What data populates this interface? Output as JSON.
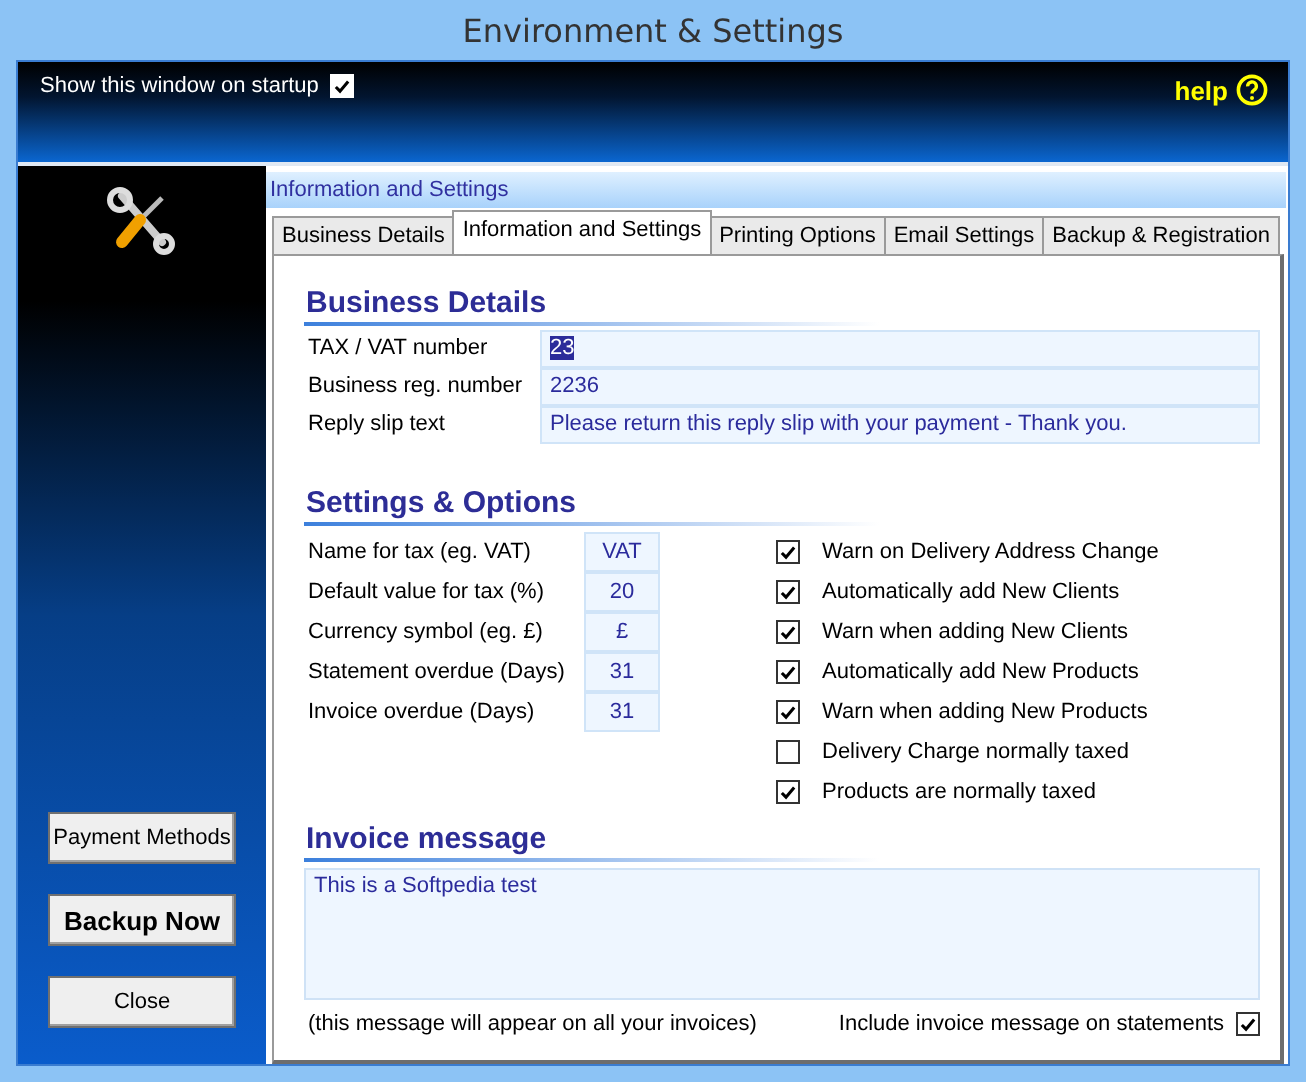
{
  "window": {
    "title": "Environment & Settings"
  },
  "header": {
    "startup_label": "Show this window on startup",
    "startup_checked": true,
    "help_label": "help"
  },
  "sidebar": {
    "buttons": [
      {
        "label": "Payment Methods",
        "bold": false
      },
      {
        "label": "Backup Now",
        "bold": true
      },
      {
        "label": "Close",
        "bold": false
      }
    ]
  },
  "panel_title": "Information and Settings",
  "tabs": [
    {
      "label": "Business Details",
      "selected": false
    },
    {
      "label": "Information and Settings",
      "selected": true
    },
    {
      "label": "Printing Options",
      "selected": false
    },
    {
      "label": "Email Settings",
      "selected": false
    },
    {
      "label": "Backup &  Registration",
      "selected": false
    }
  ],
  "business_details": {
    "heading": "Business Details",
    "fields": [
      {
        "label": "TAX / VAT number",
        "value": "23",
        "highlighted": true
      },
      {
        "label": "Business reg. number",
        "value": "2236",
        "highlighted": false
      },
      {
        "label": "Reply slip text",
        "value": "Please return this reply slip with your payment - Thank you.",
        "highlighted": false
      }
    ]
  },
  "settings": {
    "heading": "Settings & Options",
    "fields": [
      {
        "label": "Name for tax (eg. VAT)",
        "value": "VAT"
      },
      {
        "label": "Default value for tax (%)",
        "value": "20"
      },
      {
        "label": "Currency symbol (eg. £)",
        "value": "£"
      },
      {
        "label": "Statement overdue (Days)",
        "value": "31"
      },
      {
        "label": "Invoice overdue (Days)",
        "value": "31"
      }
    ],
    "options": [
      {
        "label": "Warn on Delivery Address Change",
        "checked": true
      },
      {
        "label": "Automatically add New Clients",
        "checked": true
      },
      {
        "label": "Warn when adding New Clients",
        "checked": true
      },
      {
        "label": "Automatically add New Products",
        "checked": true
      },
      {
        "label": "Warn when adding New Products",
        "checked": true
      },
      {
        "label": "Delivery Charge normally taxed",
        "checked": false
      },
      {
        "label": "Products are normally taxed",
        "checked": true
      }
    ]
  },
  "invoice_message": {
    "heading": "Invoice message",
    "value": "This is a Softpedia test",
    "note": "(this message will appear on all your invoices)",
    "include_label": "Include invoice message on statements",
    "include_checked": true
  }
}
